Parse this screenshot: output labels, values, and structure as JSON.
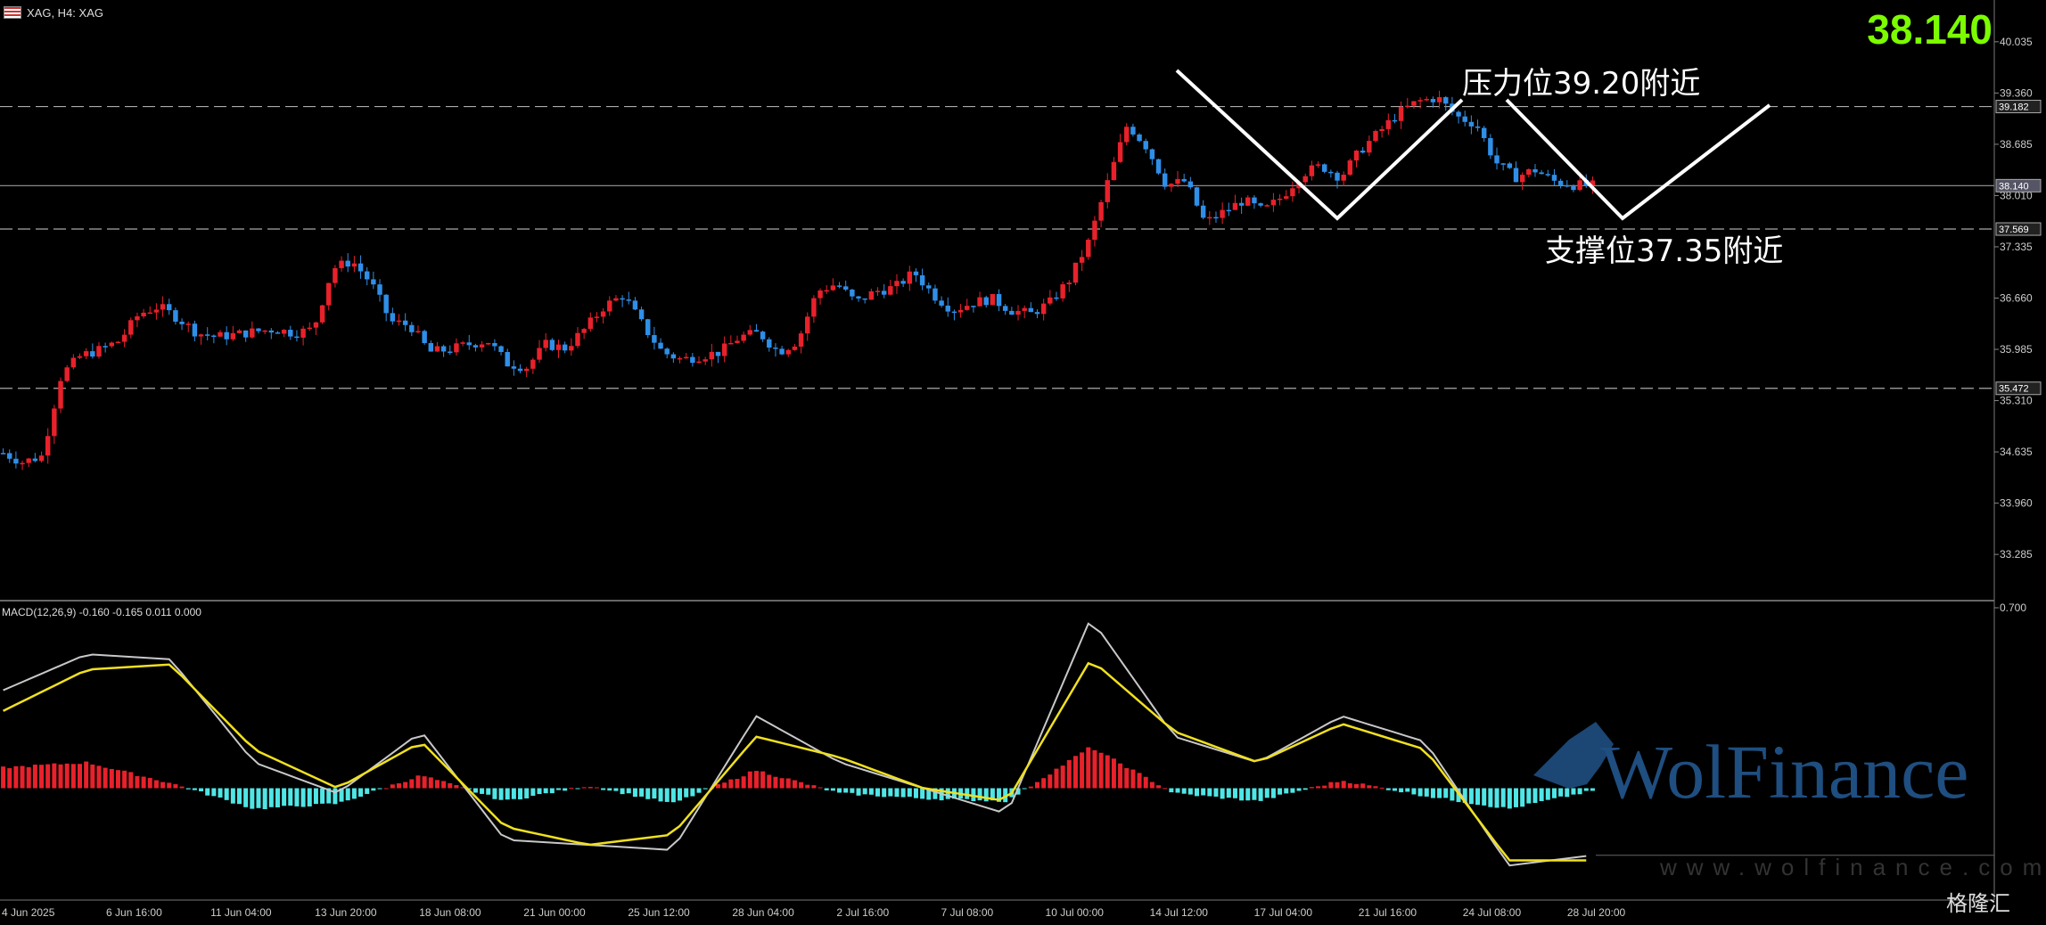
{
  "header": {
    "symbol": "XAG, H4: XAG"
  },
  "current_price": "38.140",
  "annotations": {
    "resistance": "压力位39.20附近",
    "support": "支撑位37.35附近"
  },
  "macd_label": "MACD(12,26,9) -0.160 -0.165 0.011 0.000",
  "watermark": {
    "brand": "WolFinance",
    "site": "www.wolfinance.com",
    "logo": "格隆汇"
  },
  "colors": {
    "up": "#e8212b",
    "down": "#2f8fe8",
    "hist_pos": "#e8212b",
    "hist_neg": "#4fe6e6",
    "macd_line": "#c8c8c8",
    "signal_line": "#f0e020",
    "bg": "#000000",
    "price_highlight": "#7cfc00"
  },
  "chart_data": {
    "type": "candlestick",
    "symbol": "XAG",
    "timeframe": "H4",
    "price_axis": {
      "ticks": [
        "40.035",
        "39.360",
        "38.685",
        "38.010",
        "37.335",
        "36.660",
        "35.985",
        "35.310",
        "34.635",
        "33.960",
        "33.285"
      ],
      "range": [
        32.7,
        40.35
      ]
    },
    "time_labels": [
      "4 Jun 2025",
      "6 Jun 16:00",
      "11 Jun 04:00",
      "13 Jun 20:00",
      "18 Jun 08:00",
      "21 Jun 00:00",
      "25 Jun 12:00",
      "28 Jun 04:00",
      "2 Jul 16:00",
      "7 Jul 08:00",
      "10 Jul 00:00",
      "14 Jul 12:00",
      "17 Jul 04:00",
      "21 Jul 16:00",
      "24 Jul 08:00",
      "28 Jul 20:00"
    ],
    "levels": [
      {
        "label": "39.182",
        "value": 39.182,
        "style": "dashed"
      },
      {
        "label": "38.140",
        "value": 38.14,
        "style": "solid",
        "current": true
      },
      {
        "label": "37.569",
        "value": 37.569,
        "style": "dashed"
      },
      {
        "label": "35.472",
        "value": 35.472,
        "style": "dashed"
      }
    ],
    "close_path": [
      34.62,
      34.5,
      34.58,
      35.65,
      35.9,
      35.98,
      36.1,
      36.45,
      36.55,
      36.4,
      36.2,
      36.15,
      36.18,
      36.22,
      36.25,
      36.2,
      36.25,
      37.05,
      37.15,
      36.85,
      36.35,
      36.3,
      35.95,
      35.98,
      36.05,
      36.1,
      35.8,
      35.75,
      36.05,
      36.0,
      36.25,
      36.55,
      36.7,
      36.3,
      35.95,
      35.85,
      35.9,
      35.95,
      36.15,
      36.2,
      35.95,
      36.1,
      36.75,
      36.85,
      36.6,
      36.75,
      36.8,
      37.0,
      36.7,
      36.5,
      36.6,
      36.65,
      36.5,
      36.45,
      36.6,
      36.9,
      37.4,
      38.2,
      38.95,
      38.65,
      38.15,
      38.2,
      37.65,
      37.8,
      37.95,
      37.8,
      38.0,
      38.3,
      38.4,
      38.25,
      38.6,
      38.85,
      39.1,
      39.25,
      39.3,
      39.05,
      38.95,
      38.45,
      38.25,
      38.35,
      38.2,
      38.15,
      38.14
    ],
    "pivot_path": [
      [
        0,
        34.62
      ],
      [
        4,
        35.9
      ],
      [
        10,
        36.2
      ],
      [
        17,
        37.15
      ],
      [
        22,
        35.95
      ],
      [
        31,
        36.55
      ],
      [
        36,
        35.85
      ],
      [
        42,
        36.75
      ],
      [
        47,
        37.0
      ],
      [
        53,
        36.45
      ],
      [
        58,
        38.95
      ],
      [
        62,
        37.65
      ],
      [
        70,
        38.6
      ],
      [
        74,
        39.3
      ],
      [
        80,
        38.2
      ],
      [
        82,
        38.14
      ]
    ],
    "projection_path": [
      [
        1320,
        79
      ],
      [
        1500,
        245
      ],
      [
        1640,
        112
      ],
      [
        1690,
        112
      ],
      [
        1820,
        245
      ],
      [
        1985,
        118
      ]
    ],
    "macd": {
      "axis_top_label": "0.700",
      "parameters": "12,26,9",
      "values": [
        -0.16,
        -0.165,
        0.011,
        0.0
      ],
      "line_path": [
        0.38,
        0.52,
        0.5,
        0.1,
        -0.02,
        0.22,
        -0.2,
        -0.22,
        -0.24,
        0.28,
        0.1,
        0.0,
        -0.1,
        0.66,
        0.2,
        0.1,
        0.28,
        0.18,
        -0.3,
        -0.26
      ],
      "signal_path": [
        0.3,
        0.46,
        0.48,
        0.15,
        0.0,
        0.18,
        -0.15,
        -0.22,
        -0.18,
        0.2,
        0.12,
        0.0,
        -0.05,
        0.5,
        0.22,
        0.1,
        0.25,
        0.15,
        -0.28,
        -0.28
      ],
      "hist_path": [
        0.08,
        0.1,
        0.02,
        -0.08,
        -0.06,
        0.05,
        -0.05,
        0.01,
        -0.06,
        0.07,
        -0.02,
        -0.04,
        -0.05,
        0.16,
        -0.02,
        -0.05,
        0.03,
        -0.03,
        -0.08,
        -0.01
      ]
    }
  }
}
